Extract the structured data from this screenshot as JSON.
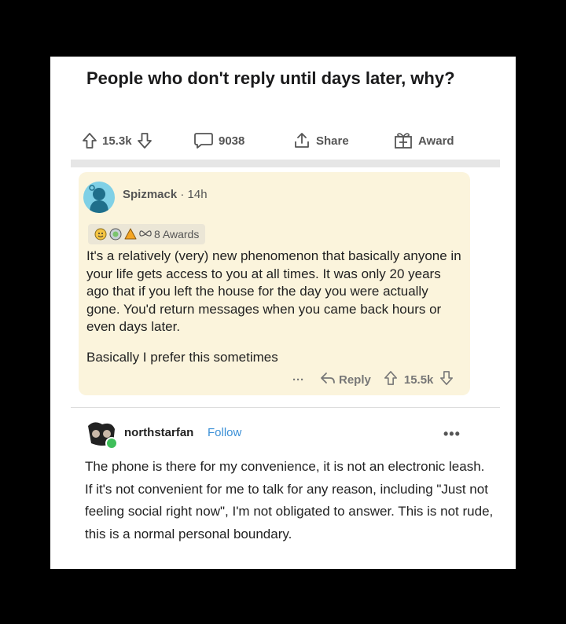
{
  "post": {
    "title": "People who don't reply until days later, why?",
    "upvotes": "15.3k",
    "comments": "9038",
    "share_label": "Share",
    "award_label": "Award"
  },
  "comment": {
    "author": "Spizmack",
    "separator": "·",
    "time": "14h",
    "awards_label": "8 Awards",
    "body_p1": "It's a relatively (very) new phenomenon that basically anyone in your life gets access to you at all times. It was only 20 years ago that if you left the house for the day you were actually gone. You'd return messages when you came back hours or even days later.",
    "body_p2": "Basically I prefer this sometimes",
    "more": "···",
    "reply_label": "Reply",
    "votes": "15.5k"
  },
  "repost": {
    "username": "northstarfan",
    "follow_label": "Follow",
    "more": "•••",
    "body": "The phone is there for my convenience, it is not an electronic leash. If it's not convenient for me to talk for any reason, including \"Just not feeling social right now\", I'm not obligated to answer. This is not rude, this is a normal personal boundary."
  },
  "colors": {
    "background": "#000000",
    "card": "#ffffff",
    "comment_bg": "#fbf4dc",
    "follow_link": "#3a8fd6"
  }
}
